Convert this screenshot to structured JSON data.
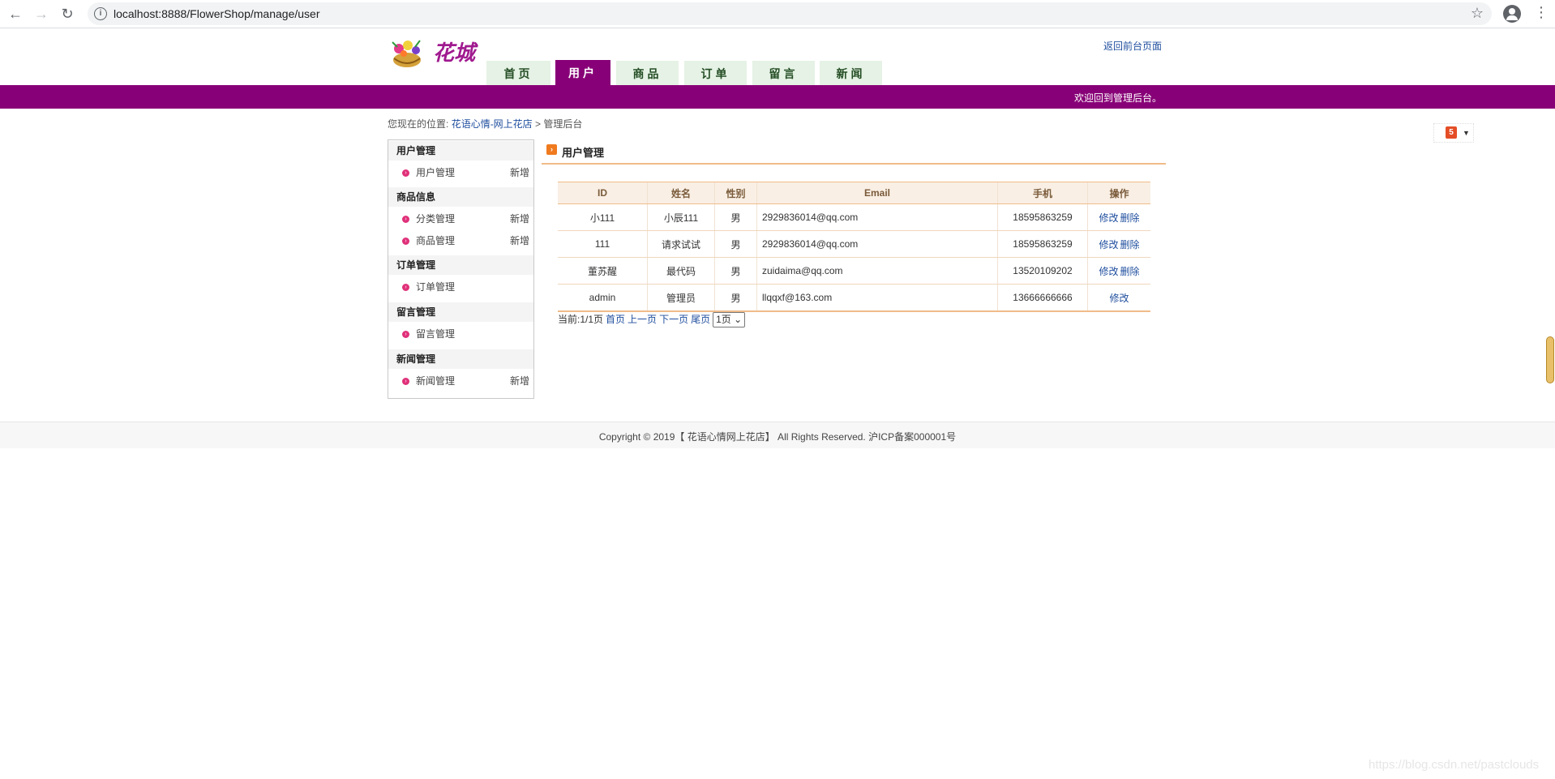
{
  "browser": {
    "url": "localhost:8888/FlowerShop/manage/user",
    "info_glyph": "i",
    "back_glyph": "←",
    "forward_glyph": "→",
    "reload_glyph": "↻",
    "star_glyph": "☆",
    "menu_glyph": "⋮"
  },
  "header": {
    "logo_text": "花城",
    "return_link": "返回前台页面",
    "tabs": [
      {
        "label": "首页",
        "active": false
      },
      {
        "label": "用户",
        "active": true
      },
      {
        "label": "商品",
        "active": false
      },
      {
        "label": "订单",
        "active": false
      },
      {
        "label": "留言",
        "active": false
      },
      {
        "label": "新闻",
        "active": false
      }
    ],
    "welcome": "欢迎回到管理后台。"
  },
  "breadcrumb": {
    "prefix": "您现在的位置:",
    "link": "花语心情-网上花店",
    "sep": ">",
    "current": "管理后台"
  },
  "badge": {
    "h5": "5",
    "caret": "▼"
  },
  "sidebar": {
    "sections": [
      {
        "title": "用户管理",
        "items": [
          {
            "label": "用户管理",
            "add": "新增"
          }
        ]
      },
      {
        "title": "商品信息",
        "items": [
          {
            "label": "分类管理",
            "add": "新增"
          },
          {
            "label": "商品管理",
            "add": "新增"
          }
        ]
      },
      {
        "title": "订单管理",
        "items": [
          {
            "label": "订单管理",
            "add": ""
          }
        ]
      },
      {
        "title": "留言管理",
        "items": [
          {
            "label": "留言管理",
            "add": ""
          }
        ]
      },
      {
        "title": "新闻管理",
        "items": [
          {
            "label": "新闻管理",
            "add": "新增"
          }
        ]
      }
    ]
  },
  "main": {
    "title": "用户管理",
    "title_icon": "›",
    "columns": [
      "ID",
      "姓名",
      "性别",
      "Email",
      "手机",
      "操作"
    ],
    "rows": [
      {
        "id": "小111",
        "name": "小辰111",
        "gender": "男",
        "email": "2929836014@qq.com",
        "phone": "18595863259",
        "edit": "修改",
        "del": "删除"
      },
      {
        "id": "111",
        "name": "请求试试",
        "gender": "男",
        "email": "2929836014@qq.com",
        "phone": "18595863259",
        "edit": "修改",
        "del": "删除"
      },
      {
        "id": "董苏醒",
        "name": "最代码",
        "gender": "男",
        "email": "zuidaima@qq.com",
        "phone": "13520109202",
        "edit": "修改",
        "del": "删除"
      },
      {
        "id": "admin",
        "name": "管理员",
        "gender": "男",
        "email": "llqqxf@163.com",
        "phone": "13666666666",
        "edit": "修改",
        "del": ""
      }
    ],
    "pager": {
      "current": "当前:1/1页",
      "first": "首页",
      "prev": "上一页",
      "next": "下一页",
      "last": "尾页",
      "select": "1页 ⌄"
    }
  },
  "footer": {
    "copyright": "Copyright © 2019【 花语心情网上花店】 All Rights Reserved. 沪ICP备案000001号"
  },
  "watermark": "https://blog.csdn.net/pastclouds"
}
